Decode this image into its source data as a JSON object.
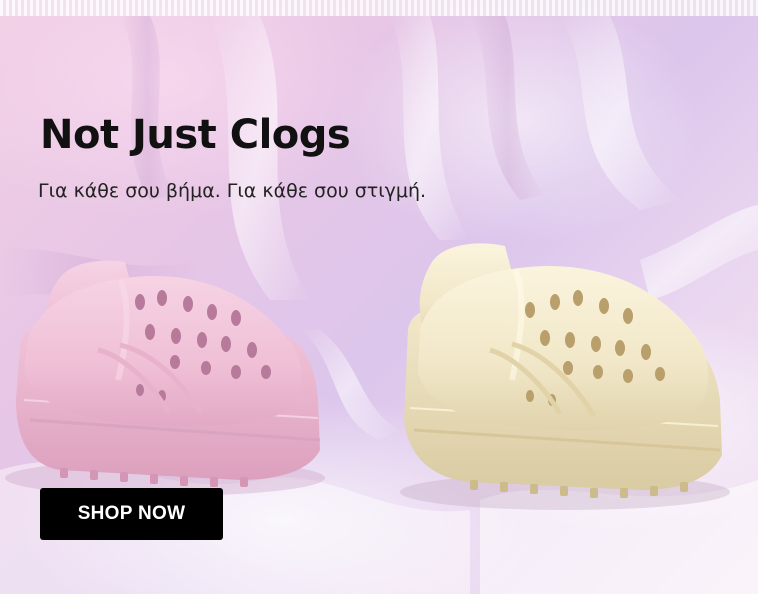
{
  "hero": {
    "headline": "Not Just Clogs",
    "subheadline": "Για κάθε σου βήμα. Για κάθε σου στιγμή.",
    "cta_label": "SHOP NOW"
  },
  "products": [
    {
      "name": "pink-clog",
      "color": "#f0bfd6"
    },
    {
      "name": "cream-clog",
      "color": "#f2ead0"
    }
  ],
  "colors": {
    "background": "#e7c6e6",
    "cta_background": "#000000",
    "cta_text": "#ffffff",
    "headline_text": "#111111"
  }
}
